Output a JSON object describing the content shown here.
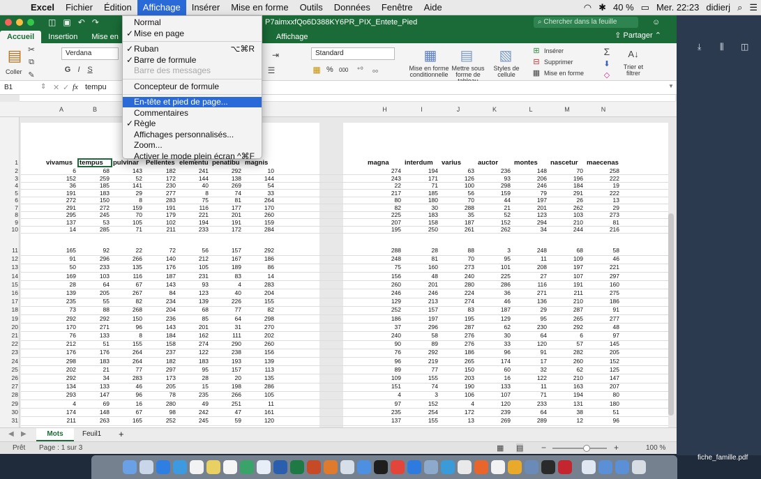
{
  "menubar": {
    "app": "Excel",
    "items": [
      "Fichier",
      "Édition",
      "Affichage",
      "Insérer",
      "Mise en forme",
      "Outils",
      "Données",
      "Fenêtre",
      "Aide"
    ],
    "active": "Affichage",
    "battery": "40 %",
    "clock": "Mer. 22:23",
    "user": "didierj"
  },
  "window": {
    "title": "P7aimxxfQo6D388KY6PR_PIX_Entete_Pied",
    "search_placeholder": "Chercher dans la feuille"
  },
  "ribbon_tabs": {
    "items": [
      "Accueil",
      "Insertion",
      "Mise en"
    ],
    "hidden_items": [
      "Affichage"
    ],
    "share": "Partager"
  },
  "ribbon": {
    "paste": "Coller",
    "font": "Verdana",
    "format": "Standard",
    "percent": "%",
    "thousands": "000",
    "cond_format": "Mise en forme conditionnelle",
    "as_table": "Mettre sous forme de tableau",
    "cell_styles": "Styles de cellule",
    "insert": "Insérer",
    "delete": "Supprimer",
    "format_btn": "Mise en forme",
    "sort_filter": "Trier et filtrer"
  },
  "formula_bar": {
    "cellref": "B1",
    "content": "tempu",
    "fx": "fx"
  },
  "view_menu": {
    "items": [
      {
        "label": "Normal",
        "checked": false,
        "disabled": false
      },
      {
        "label": "Mise en page",
        "checked": true,
        "disabled": false
      },
      {
        "sep": true
      },
      {
        "label": "Ruban",
        "checked": true,
        "disabled": false,
        "shortcut": "⌥⌘R"
      },
      {
        "label": "Barre de formule",
        "checked": true,
        "disabled": false
      },
      {
        "label": "Barre des messages",
        "checked": false,
        "disabled": true
      },
      {
        "sep": true
      },
      {
        "label": "Concepteur de formule",
        "checked": false,
        "disabled": false
      },
      {
        "sep": true
      },
      {
        "label": "En-tête et pied de page...",
        "checked": false,
        "disabled": false,
        "highlight": true
      },
      {
        "label": "Commentaires",
        "checked": false,
        "disabled": false
      },
      {
        "label": "Règle",
        "checked": true,
        "disabled": false
      },
      {
        "label": "Affichages personnalisés...",
        "checked": false,
        "disabled": false
      },
      {
        "label": "Zoom...",
        "checked": false,
        "disabled": false
      },
      {
        "label": "Activer le mode plein écran",
        "checked": false,
        "disabled": false,
        "shortcut": "^⌘F"
      }
    ]
  },
  "sheet": {
    "left_columns": [
      "A",
      "B",
      "C",
      "D",
      "E",
      "F",
      "G"
    ],
    "right_columns": [
      "H",
      "I",
      "J",
      "K",
      "L",
      "M",
      "N"
    ],
    "left_headers": [
      "vivamus",
      "tempus",
      "pulvinar",
      "Pellentes",
      "elementu",
      "penatibu",
      "magnis"
    ],
    "right_headers": [
      "magna",
      "interdum",
      "varius",
      "auctor",
      "montes",
      "nascetur",
      "maecenas"
    ],
    "rows": [
      [
        6,
        68,
        143,
        182,
        241,
        292,
        10,
        274,
        194,
        63,
        236,
        148,
        70,
        258
      ],
      [
        152,
        259,
        52,
        172,
        144,
        138,
        144,
        243,
        171,
        126,
        93,
        206,
        196,
        222
      ],
      [
        36,
        185,
        141,
        230,
        40,
        269,
        54,
        22,
        71,
        100,
        298,
        246,
        184,
        19
      ],
      [
        191,
        183,
        29,
        277,
        8,
        74,
        33,
        217,
        185,
        56,
        159,
        79,
        291,
        222
      ],
      [
        272,
        150,
        8,
        283,
        75,
        81,
        264,
        80,
        180,
        70,
        44,
        197,
        26,
        13
      ],
      [
        291,
        272,
        159,
        191,
        116,
        177,
        170,
        82,
        30,
        288,
        21,
        201,
        262,
        29
      ],
      [
        295,
        245,
        70,
        179,
        221,
        201,
        260,
        225,
        183,
        35,
        52,
        123,
        103,
        273
      ],
      [
        137,
        53,
        105,
        102,
        194,
        191,
        159,
        207,
        158,
        187,
        152,
        294,
        210,
        81
      ],
      [
        14,
        285,
        71,
        211,
        233,
        172,
        284,
        195,
        250,
        261,
        262,
        34,
        244,
        216
      ],
      [
        165,
        92,
        22,
        72,
        56,
        157,
        292,
        288,
        28,
        88,
        3,
        248,
        68,
        58
      ],
      [
        91,
        296,
        266,
        140,
        212,
        167,
        186,
        248,
        81,
        70,
        95,
        11,
        109,
        46
      ],
      [
        50,
        233,
        135,
        176,
        105,
        189,
        86,
        75,
        160,
        273,
        101,
        208,
        197,
        221
      ],
      [
        169,
        103,
        116,
        187,
        231,
        83,
        14,
        156,
        48,
        240,
        225,
        27,
        107,
        297
      ],
      [
        28,
        64,
        67,
        143,
        93,
        4,
        283,
        260,
        201,
        280,
        286,
        116,
        191,
        160
      ],
      [
        139,
        205,
        267,
        84,
        123,
        40,
        204,
        246,
        246,
        224,
        36,
        271,
        211,
        275
      ],
      [
        235,
        55,
        82,
        234,
        139,
        226,
        155,
        129,
        213,
        274,
        46,
        136,
        210,
        186
      ],
      [
        73,
        88,
        268,
        204,
        68,
        77,
        82,
        252,
        157,
        83,
        187,
        29,
        287,
        91
      ],
      [
        292,
        292,
        150,
        236,
        85,
        64,
        298,
        186,
        197,
        195,
        129,
        95,
        265,
        277
      ],
      [
        170,
        271,
        96,
        143,
        201,
        31,
        270,
        37,
        296,
        287,
        62,
        230,
        292,
        48
      ],
      [
        76,
        133,
        8,
        184,
        162,
        111,
        202,
        240,
        58,
        276,
        30,
        64,
        6,
        97
      ],
      [
        212,
        51,
        155,
        158,
        274,
        290,
        260,
        90,
        89,
        276,
        33,
        120,
        57,
        145
      ],
      [
        176,
        176,
        264,
        237,
        122,
        238,
        156,
        76,
        292,
        186,
        96,
        91,
        282,
        205
      ],
      [
        298,
        183,
        264,
        182,
        183,
        193,
        139,
        96,
        219,
        265,
        174,
        17,
        260,
        152
      ],
      [
        202,
        21,
        77,
        297,
        95,
        157,
        113,
        89,
        77,
        150,
        60,
        32,
        62,
        125
      ],
      [
        292,
        34,
        283,
        173,
        28,
        20,
        135,
        109,
        155,
        203,
        16,
        122,
        210,
        147
      ],
      [
        134,
        133,
        46,
        205,
        15,
        198,
        286,
        151,
        74,
        190,
        133,
        11,
        163,
        207
      ],
      [
        293,
        147,
        96,
        78,
        235,
        266,
        105,
        4,
        3,
        106,
        107,
        71,
        194,
        80
      ],
      [
        4,
        69,
        16,
        280,
        49,
        251,
        11,
        97,
        152,
        4,
        120,
        233,
        131,
        180
      ],
      [
        174,
        148,
        67,
        98,
        242,
        47,
        161,
        235,
        254,
        172,
        239,
        64,
        38,
        51
      ],
      [
        211,
        263,
        165,
        252,
        245,
        59,
        120,
        137,
        155,
        13,
        269,
        289,
        12,
        96
      ]
    ]
  },
  "sheet_tabs": {
    "tabs": [
      "Mots",
      "Feuil1"
    ],
    "add": "+"
  },
  "status": {
    "ready": "Prêt",
    "page": "Page : 1 sur 3",
    "zoom": "100 %"
  },
  "desktop": {
    "file": "fiche_famille.pdf"
  },
  "colors": {
    "excel_green": "#1a6b37",
    "menu_highlight": "#2a6ad8"
  }
}
